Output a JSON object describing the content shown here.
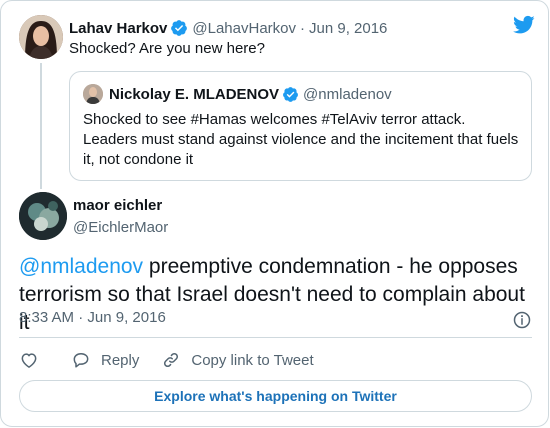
{
  "colors": {
    "brand": "#1d9bf0",
    "text": "#0f1419",
    "muted": "#536471",
    "border": "#cfd9de"
  },
  "parent": {
    "name": "Lahav Harkov",
    "handle": "@LahavHarkov",
    "separator": "·",
    "date": "Jun 9, 2016",
    "text": "Shocked? Are you new here?",
    "avatar_icon": "user-avatar",
    "verified_icon": "verified-badge-icon"
  },
  "quote": {
    "name": "Nickolay E. MLADENOV",
    "handle": "@nmladenov",
    "text": "Shocked to see #Hamas welcomes #TelAviv terror attack. Leaders must stand against violence and the incitement that fuels it, not condone it",
    "avatar_icon": "user-avatar",
    "verified_icon": "verified-badge-icon"
  },
  "tweet": {
    "name": "maor eichler",
    "handle": "@EichlerMaor",
    "mention": "@nmladenov",
    "text": " preemptive condemnation - he opposes terrorism so that Israel doesn't need to complain about it",
    "time": "8:33 AM",
    "separator": "·",
    "date": "Jun 9, 2016",
    "avatar_icon": "user-avatar"
  },
  "actions": {
    "like_icon": "heart-icon",
    "reply_icon": "reply-bubble-icon",
    "reply_label": "Reply",
    "copy_icon": "link-icon",
    "copy_label": "Copy link to Tweet"
  },
  "info_icon": "info-icon",
  "brand_icon": "twitter-bird-icon",
  "explore_label": "Explore what's happening on Twitter"
}
